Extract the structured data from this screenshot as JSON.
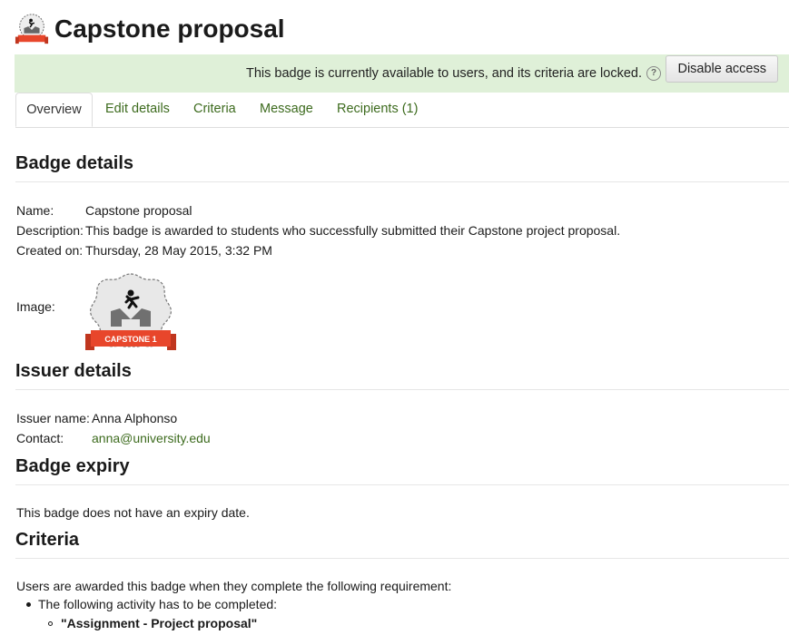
{
  "header": {
    "title": "Capstone proposal",
    "icon": "badge-icon"
  },
  "notice": {
    "text": "This badge is currently available to users, and its criteria are locked.",
    "button_label": "Disable access",
    "help_glyph": "?"
  },
  "tabs": [
    {
      "label": "Overview"
    },
    {
      "label": "Edit details"
    },
    {
      "label": "Criteria"
    },
    {
      "label": "Message"
    },
    {
      "label": "Recipients (1)"
    }
  ],
  "badge_details": {
    "heading": "Badge details",
    "name_label": "Name:",
    "name": "Capstone proposal",
    "description_label": "Description:",
    "description": "This badge is awarded to students who successfully submitted their Capstone project proposal.",
    "created_label": "Created on:",
    "created": "Thursday, 28 May 2015, 3:32 PM",
    "image_label": "Image:",
    "image_ribbon_text": "CAPSTONE 1"
  },
  "issuer_details": {
    "heading": "Issuer details",
    "issuer_label": "Issuer name:",
    "issuer_name": "Anna Alphonso",
    "contact_label": "Contact:",
    "contact": "anna@university.edu"
  },
  "badge_expiry": {
    "heading": "Badge expiry",
    "text": "This badge does not have an expiry date."
  },
  "criteria": {
    "heading": "Criteria",
    "intro": "Users are awarded this badge when they complete the following requirement:",
    "item": "The following activity has to be completed:",
    "subitem": "\"Assignment - Project proposal\""
  },
  "colors": {
    "link": "#3d6b1e",
    "notice_bg": "#dff0d8",
    "ribbon": "#e8462b"
  }
}
